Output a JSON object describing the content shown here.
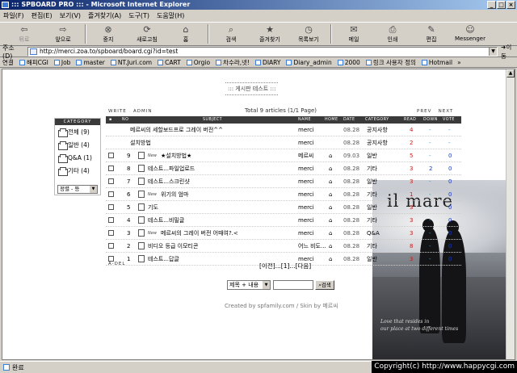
{
  "window": {
    "title": "::: SPBOARD PRO ::: - Microsoft Internet Explorer",
    "min": "_",
    "max": "□",
    "close": "×"
  },
  "menu": [
    "파일(F)",
    "편집(E)",
    "보기(V)",
    "즐겨찾기(A)",
    "도구(T)",
    "도움말(H)"
  ],
  "toolbar": [
    {
      "label": "뒤로",
      "icon": "back-arrow-icon",
      "glyph": "⇦"
    },
    {
      "label": "앞으로",
      "icon": "forward-arrow-icon",
      "glyph": "⇨"
    },
    {
      "label": "중지",
      "icon": "stop-icon",
      "glyph": "⊗"
    },
    {
      "label": "새로고침",
      "icon": "refresh-icon",
      "glyph": "⟳"
    },
    {
      "label": "홈",
      "icon": "home-icon",
      "glyph": "⌂"
    },
    {
      "label": "검색",
      "icon": "search-icon",
      "glyph": "⌕"
    },
    {
      "label": "즐겨찾기",
      "icon": "favorites-icon",
      "glyph": "★"
    },
    {
      "label": "목록보기",
      "icon": "history-icon",
      "glyph": "◷"
    },
    {
      "label": "메일",
      "icon": "mail-icon",
      "glyph": "✉"
    },
    {
      "label": "인쇄",
      "icon": "print-icon",
      "glyph": "⎙"
    },
    {
      "label": "편집",
      "icon": "edit-icon",
      "glyph": "✎"
    },
    {
      "label": "Messenger",
      "icon": "messenger-icon",
      "glyph": "☺"
    }
  ],
  "address": {
    "label": "주소(D)",
    "url": "http://merci.zoa.to/spboard/board.cgi?id=test",
    "go": "이동"
  },
  "links": {
    "label": "연결",
    "items": [
      "해피CGI",
      "Job",
      "master",
      "NT.Juri.com",
      "CART",
      "Orgio",
      "차수라,넷!",
      "DIARY",
      "Diary_admin",
      "2000",
      "링크 사용자 정의",
      "Hotmail"
    ],
    "more": "»"
  },
  "status": {
    "text": "완료"
  },
  "copyright": "Copyright(c) http://www.happycgi.com",
  "board": {
    "title": "::: 게시판 테스트 :::",
    "write": "WRITE",
    "admin": "ADMIN",
    "total": "Total 9 articles (1/1 Page)",
    "prev": "PREV",
    "next": "NEXT"
  },
  "category": {
    "header": "CATEGORY",
    "items": [
      "전체 (9)",
      "일반 (4)",
      "Q&A (1)",
      "기타 (4)"
    ],
    "sort": "정렬 - 등"
  },
  "table": {
    "headers": [
      "NO",
      "SUBJECT",
      "NAME",
      "HOME",
      "DATE",
      "CATEGORY",
      "READ",
      "DOWN",
      "VOTE"
    ],
    "rows": [
      {
        "no": "",
        "subject": "메르씨의 세할보드프로 그레이 버전^^",
        "name": "merci",
        "date": "08.28",
        "category": "공지사항",
        "read": "4",
        "down": "-",
        "vote": "-",
        "notice": true,
        "new": false
      },
      {
        "no": "",
        "subject": "설치방법",
        "name": "merci",
        "date": "08.28",
        "category": "공지사항",
        "read": "2",
        "down": "-",
        "vote": "-",
        "notice": true,
        "new": false
      },
      {
        "no": "9",
        "subject": "★설치방법★",
        "name": "메르씨",
        "date": "09.03",
        "category": "일반",
        "read": "5",
        "down": "-",
        "vote": "0",
        "notice": false,
        "new": true
      },
      {
        "no": "8",
        "subject": "테스트...파일업로드",
        "name": "merci",
        "date": "08.28",
        "category": "기타",
        "read": "3",
        "down": "2",
        "vote": "0",
        "notice": false,
        "new": false
      },
      {
        "no": "7",
        "subject": "테스트...스크린샷",
        "name": "merci",
        "date": "08.28",
        "category": "일반",
        "read": "3",
        "down": "-",
        "vote": "0",
        "notice": false,
        "new": false
      },
      {
        "no": "6",
        "subject": "위기의 엄마",
        "name": "merci",
        "date": "08.28",
        "category": "기타",
        "read": "1",
        "down": "-",
        "vote": "0",
        "notice": false,
        "new": true
      },
      {
        "no": "5",
        "subject": "기도",
        "name": "merci",
        "date": "08.28",
        "category": "일반",
        "read": "3",
        "down": "-",
        "vote": "0",
        "notice": false,
        "new": false
      },
      {
        "no": "4",
        "subject": "테스트...비밀글",
        "name": "merci",
        "date": "08.28",
        "category": "기타",
        "read": "3",
        "down": "-",
        "vote": "0",
        "notice": false,
        "new": false
      },
      {
        "no": "3",
        "subject": "메르씨의 그레이 버전 어때여?.<",
        "name": "merci",
        "date": "08.28",
        "category": "Q&A",
        "read": "3",
        "down": "-",
        "vote": "0",
        "notice": false,
        "new": true
      },
      {
        "no": "2",
        "subject": "비디오 등급 이모티콘",
        "name": "어느 비도...",
        "date": "08.28",
        "category": "기타",
        "read": "8",
        "down": "-",
        "vote": "0",
        "notice": false,
        "new": false
      },
      {
        "no": "1",
        "subject": "테스트...답글",
        "name": "merci",
        "date": "08.28",
        "category": "일반",
        "read": "3",
        "down": "-",
        "vote": "0",
        "notice": false,
        "new": false
      }
    ]
  },
  "nav": {
    "adel": "A-DEL",
    "pages": "[이전]...[1]...[다음]"
  },
  "search": {
    "select": "제목 + 내용",
    "button": "검색"
  },
  "footer": "Created by spfamily.com / Skin by 메르씨",
  "photo": {
    "title": "il mare",
    "sub": "Love that resides in",
    "cap1": "Love that resides in",
    "cap2": "our place at two different times"
  }
}
